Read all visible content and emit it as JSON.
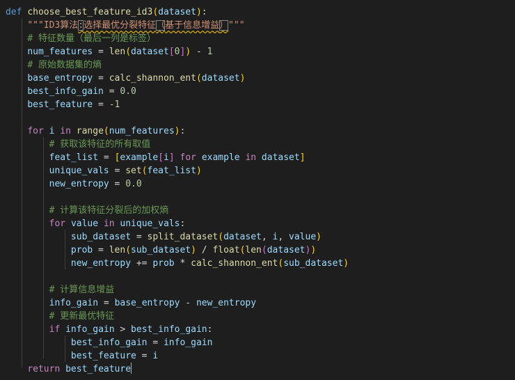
{
  "l1": {
    "kw": "def",
    "fn": "choose_best_feature_id3",
    "p_open": "(",
    "param": "dataset",
    "p_close": ")",
    "colon": ":"
  },
  "l2": {
    "q_open": "\"\"\"",
    "a": "ID3算法",
    "b": ":",
    "c": "选择最优分裂特征",
    "d": "（",
    "e": "基于信息增益",
    "f": "）",
    "q_close": "\"\"\""
  },
  "l3": {
    "text": "# 特征数量（最后一列是标签）"
  },
  "l4": {
    "var": "num_features",
    "eq": " = ",
    "fn": "len",
    "p_open": "(",
    "arg": "dataset",
    "b_open": "[",
    "idx": "0",
    "b_close": "]",
    "p_close": ")",
    "minus": " - ",
    "num": "1"
  },
  "l5": {
    "text": "# 原始数据集的熵"
  },
  "l6": {
    "var": "base_entropy",
    "eq": " = ",
    "fn": "calc_shannon_ent",
    "p_open": "(",
    "arg": "dataset",
    "p_close": ")"
  },
  "l7": {
    "var": "best_info_gain",
    "eq": " = ",
    "num": "0.0"
  },
  "l8": {
    "var": "best_feature",
    "eq": " = ",
    "num": "-1"
  },
  "l10": {
    "kw": "for",
    "var": "i",
    "kw2": "in",
    "fn": "range",
    "p_open": "(",
    "arg": "num_features",
    "p_close": ")",
    "colon": ":"
  },
  "l11": {
    "text": "# 获取该特征的所有取值"
  },
  "l12": {
    "var": "feat_list",
    "eq": " = ",
    "b_open": "[",
    "v1": "example",
    "b2_open": "[",
    "v2": "i",
    "b2_close": "]",
    "kw": "for",
    "v3": "example",
    "kw2": "in",
    "v4": "dataset",
    "b_close": "]"
  },
  "l13": {
    "var": "unique_vals",
    "eq": " = ",
    "fn": "set",
    "p_open": "(",
    "arg": "feat_list",
    "p_close": ")"
  },
  "l14": {
    "var": "new_entropy",
    "eq": " = ",
    "num": "0.0"
  },
  "l16": {
    "text": "# 计算该特征分裂后的加权熵"
  },
  "l17": {
    "kw": "for",
    "var": "value",
    "kw2": "in",
    "var2": "unique_vals",
    "colon": ":"
  },
  "l18": {
    "var": "sub_dataset",
    "eq": " = ",
    "fn": "split_dataset",
    "p_open": "(",
    "a1": "dataset",
    "comma1": ", ",
    "a2": "i",
    "comma2": ", ",
    "a3": "value",
    "p_close": ")"
  },
  "l19": {
    "var": "prob",
    "eq": " = ",
    "fn": "len",
    "p_open": "(",
    "a1": "sub_dataset",
    "p_close": ")",
    "div": " / ",
    "fn2": "float",
    "p2_open": "(",
    "fn3": "len",
    "p3_open": "(",
    "a2": "dataset",
    "p3_close": ")",
    "p2_close": ")"
  },
  "l20": {
    "var": "new_entropy",
    "op": " += ",
    "v2": "prob",
    "mul": " * ",
    "fn": "calc_shannon_ent",
    "p_open": "(",
    "arg": "sub_dataset",
    "p_close": ")"
  },
  "l22": {
    "text": "# 计算信息增益"
  },
  "l23": {
    "var": "info_gain",
    "eq": " = ",
    "v2": "base_entropy",
    "minus": " - ",
    "v3": "new_entropy"
  },
  "l24": {
    "text": "# 更新最优特征"
  },
  "l25": {
    "kw": "if",
    "var": "info_gain",
    "gt": " > ",
    "var2": "best_info_gain",
    "colon": ":"
  },
  "l26": {
    "var": "best_info_gain",
    "eq": " = ",
    "var2": "info_gain"
  },
  "l27": {
    "var": "best_feature",
    "eq": " = ",
    "var2": "i"
  },
  "l28": {
    "kw": "return",
    "var": "best_feature"
  }
}
